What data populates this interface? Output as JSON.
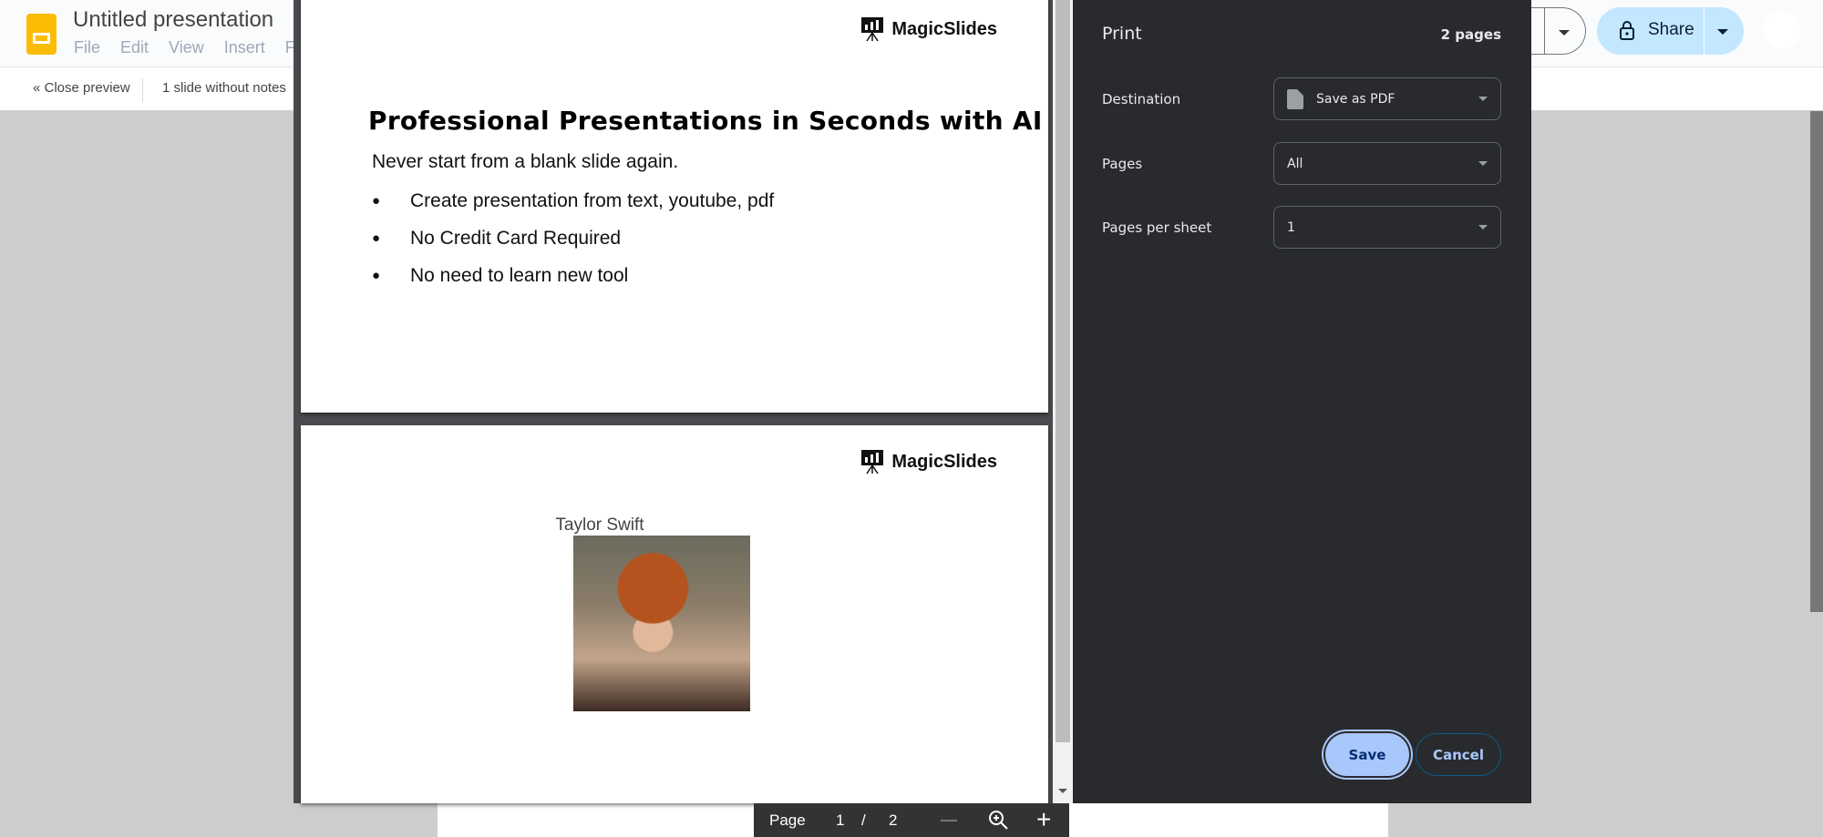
{
  "app": {
    "title": "Untitled presentation",
    "menu": [
      "File",
      "Edit",
      "View",
      "Insert",
      "F"
    ],
    "close_preview": "« Close preview",
    "notes_option": "1 slide without notes",
    "share": "Share"
  },
  "slides": [
    {
      "logo": "MagicSlides",
      "title": "Professional Presentations in Seconds with AI",
      "subtitle": "Never start from a blank slide again.",
      "bullets": [
        "Create presentation from text, youtube, pdf",
        "No Credit Card Required",
        "No need to learn new tool"
      ]
    },
    {
      "logo": "MagicSlides",
      "caption": "Taylor Swift"
    }
  ],
  "print": {
    "title": "Print",
    "page_count": "2 pages",
    "fields": [
      {
        "label": "Destination",
        "value": "Save as PDF",
        "icon": "file-icon"
      },
      {
        "label": "Pages",
        "value": "All"
      },
      {
        "label": "Pages per sheet",
        "value": "1"
      }
    ],
    "save": "Save",
    "cancel": "Cancel"
  },
  "pdf_toolbar": {
    "label": "Page",
    "current": "1",
    "sep": "/",
    "total": "2"
  },
  "background_caption": "Taylor Swift",
  "colors": {
    "panel": "#292a2d",
    "share": "#c2e7ff",
    "save": "#a8c7fa",
    "slides_icon": "#fbbc04"
  }
}
